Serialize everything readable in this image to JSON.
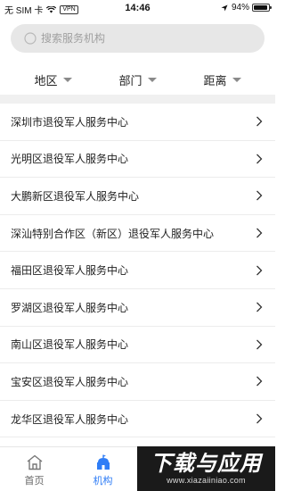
{
  "status_bar": {
    "carrier": "无 SIM 卡",
    "vpn": "VPN",
    "time": "14:46",
    "battery": "94%",
    "battery_level": 0.94
  },
  "search": {
    "placeholder": "搜索服务机构"
  },
  "filters": [
    {
      "label": "地区"
    },
    {
      "label": "部门"
    },
    {
      "label": "距离"
    }
  ],
  "list": [
    {
      "label": "深圳市退役军人服务中心"
    },
    {
      "label": "光明区退役军人服务中心"
    },
    {
      "label": "大鹏新区退役军人服务中心"
    },
    {
      "label": "深汕特别合作区（新区）退役军人服务中心"
    },
    {
      "label": "福田区退役军人服务中心"
    },
    {
      "label": "罗湖区退役军人服务中心"
    },
    {
      "label": "南山区退役军人服务中心"
    },
    {
      "label": "宝安区退役军人服务中心"
    },
    {
      "label": "龙华区退役军人服务中心"
    }
  ],
  "tabbar": {
    "tabs": [
      {
        "label": "首页",
        "icon": "home-icon"
      },
      {
        "label": "机构",
        "icon": "institution-icon"
      }
    ],
    "active_color": "#2f7df6"
  },
  "watermark": {
    "title": "下载与应用",
    "url": "www.xiazaiiniao.com"
  }
}
